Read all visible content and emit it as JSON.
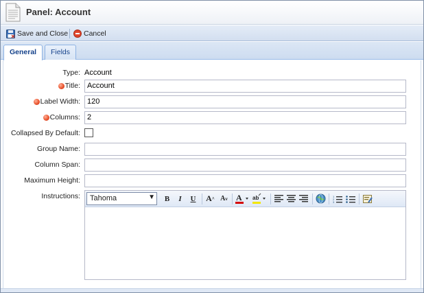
{
  "header": {
    "title": "Panel: Account",
    "icon": "document-icon"
  },
  "toolbar": {
    "save_close_label": "Save and Close",
    "cancel_label": "Cancel"
  },
  "tabs": [
    {
      "label": "General",
      "active": true
    },
    {
      "label": "Fields",
      "active": false
    }
  ],
  "form": {
    "type": {
      "label": "Type:",
      "value": "Account"
    },
    "title": {
      "label": "Title:",
      "value": "Account",
      "required": true
    },
    "label_width": {
      "label": "Label Width:",
      "value": "120",
      "required": true
    },
    "columns": {
      "label": "Columns:",
      "value": "2",
      "required": true
    },
    "collapsed": {
      "label": "Collapsed By Default:",
      "checked": false
    },
    "group_name": {
      "label": "Group Name:",
      "value": ""
    },
    "column_span": {
      "label": "Column Span:",
      "value": ""
    },
    "max_height": {
      "label": "Maximum Height:",
      "value": ""
    },
    "instructions": {
      "label": "Instructions:",
      "value": ""
    }
  },
  "editor": {
    "font": "Tahoma",
    "buttons": [
      "bold-icon",
      "italic-icon",
      "underline-icon",
      "grow-text-icon",
      "shrink-text-icon",
      "font-color-icon",
      "highlight-icon",
      "align-left-icon",
      "align-center-icon",
      "align-right-icon",
      "insert-link-icon",
      "numbered-list-icon",
      "bullet-list-icon",
      "source-edit-icon"
    ]
  },
  "colors": {
    "accent": "#15428b",
    "required": "#e8502a",
    "toolbar": "#d3dff0"
  }
}
